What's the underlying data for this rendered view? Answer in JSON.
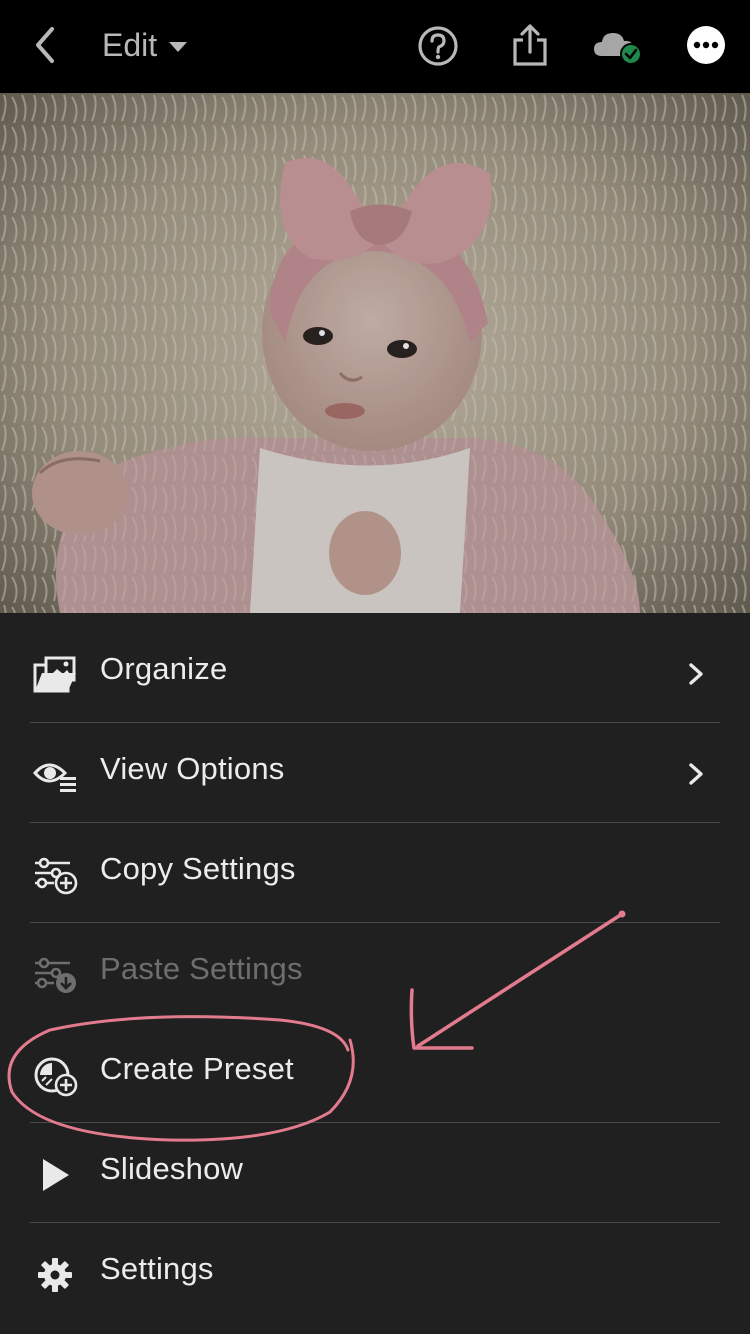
{
  "header": {
    "edit_label": "Edit",
    "icons": [
      "back-chevron-icon",
      "help-icon",
      "share-icon",
      "cloud-sync-icon",
      "more-icon"
    ]
  },
  "photo": {
    "description_icon": "photo"
  },
  "menu": {
    "items": [
      {
        "label": "Organize",
        "icon": "folder-photo-icon",
        "has_chevron": true
      },
      {
        "label": "View Options",
        "icon": "eye-list-icon",
        "has_chevron": true
      },
      {
        "label": "Copy Settings",
        "icon": "sliders-plus-icon",
        "has_chevron": false
      },
      {
        "label": "Paste Settings",
        "icon": "sliders-download-icon",
        "has_chevron": false,
        "disabled": true
      },
      {
        "label": "Create Preset",
        "icon": "preset-plus-icon",
        "has_chevron": false
      },
      {
        "label": "Slideshow",
        "icon": "play-icon",
        "has_chevron": false
      },
      {
        "label": "Settings",
        "icon": "gear-icon",
        "has_chevron": false
      }
    ]
  },
  "colors": {
    "background": "#202020",
    "topbar": "#000000",
    "annotation": "#e37b8e",
    "sync_badge": "#1f8a4c"
  }
}
